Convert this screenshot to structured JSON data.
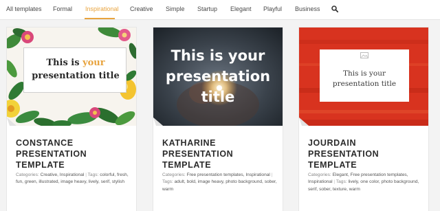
{
  "nav": {
    "items": [
      {
        "label": "All templates",
        "active": false
      },
      {
        "label": "Formal",
        "active": false
      },
      {
        "label": "Inspirational",
        "active": true
      },
      {
        "label": "Creative",
        "active": false
      },
      {
        "label": "Simple",
        "active": false
      },
      {
        "label": "Startup",
        "active": false
      },
      {
        "label": "Elegant",
        "active": false
      },
      {
        "label": "Playful",
        "active": false
      },
      {
        "label": "Business",
        "active": false
      }
    ],
    "search_icon": "search-icon",
    "accent_color": "#e8a33d"
  },
  "cards": [
    {
      "thumb": {
        "line1_a": "This is ",
        "line1_b": "your",
        "line2": "presentation title"
      },
      "title_lines": [
        "CONSTANCE",
        "PRESENTATION",
        "TEMPLATE"
      ],
      "categories_label": "Categories:",
      "categories": "Creative, Inspirational",
      "separator": "|",
      "tags_label": "Tags:",
      "tags": "colorful, fresh, fun, green, illustrated, image heavy, lively, serif, stylish"
    },
    {
      "thumb": {
        "line1": "This is your",
        "line2": "presentation",
        "line3": "title"
      },
      "title_lines": [
        "KATHARINE",
        "PRESENTATION",
        "TEMPLATE"
      ],
      "categories_label": "Categories:",
      "categories": "Free presentation templates, Inspirational",
      "separator": "|",
      "tags_label": "Tags:",
      "tags": "adult, bold, image heavy, photo background, sober, warm"
    },
    {
      "thumb": {
        "line1": "This is your",
        "line2": "presentation title"
      },
      "title_lines": [
        "JOURDAIN",
        "PRESENTATION",
        "TEMPLATE"
      ],
      "categories_label": "Categories:",
      "categories": "Elegant, Free presentation templates, Inspirational",
      "separator": "|",
      "tags_label": "Tags:",
      "tags": "lively, one color, photo background, serif, sober, texture, warm"
    }
  ]
}
